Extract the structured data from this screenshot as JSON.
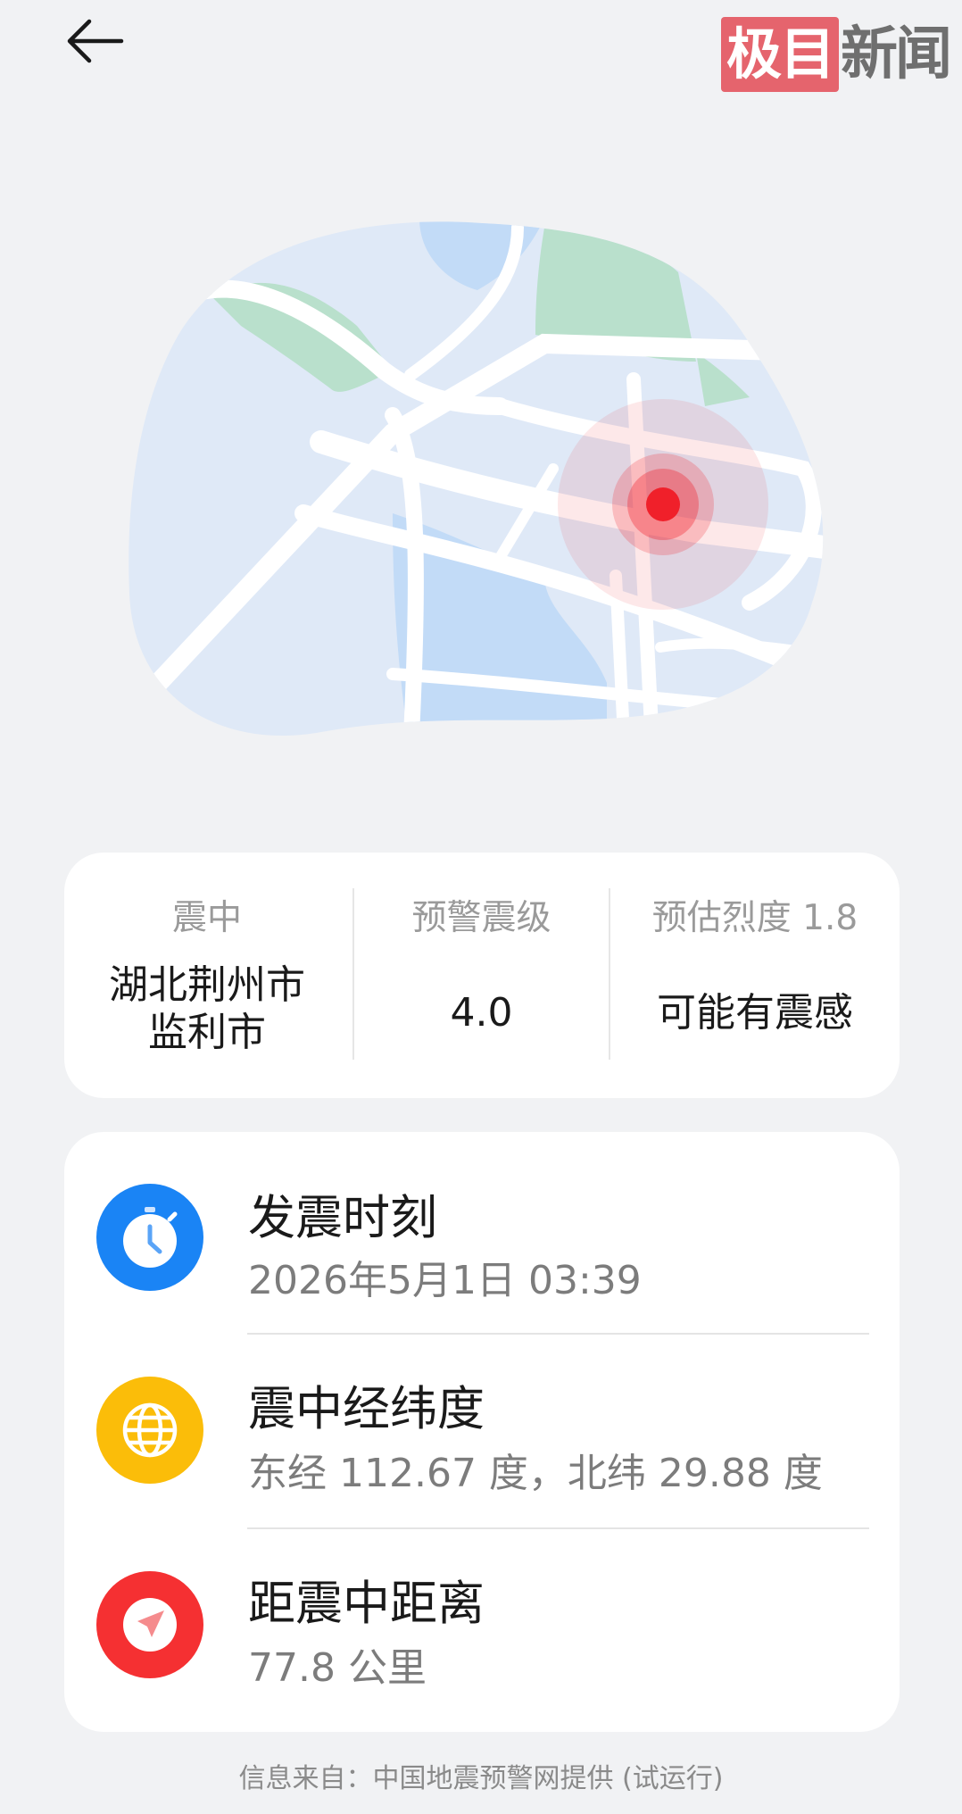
{
  "header": {
    "back_icon": "arrow-left-icon",
    "logo": {
      "highlight": "极目",
      "rest": "新闻"
    }
  },
  "map": {
    "colors": {
      "land": "#dfe9f7",
      "water": "#c2dbf7",
      "park": "#b9e0cc",
      "road": "#ffffff",
      "marker": "#f0202a"
    }
  },
  "summary": {
    "epicenter": {
      "label": "震中",
      "line1": "湖北荆州市",
      "line2": "监利市"
    },
    "magnitude": {
      "label": "预警震级",
      "value": "4.0"
    },
    "intensity": {
      "label": "预估烈度 1.8",
      "value": "可能有震感"
    }
  },
  "details": [
    {
      "title": "发震时刻",
      "value": "2026年5月1日 03:39",
      "icon": "stopwatch-icon",
      "color": "#1a84f5"
    },
    {
      "title": "震中经纬度",
      "value": "东经 112.67 度，北纬 29.88 度",
      "icon": "globe-icon",
      "color": "#fbbd09"
    },
    {
      "title": "距震中距离",
      "value": "77.8 公里",
      "icon": "navigation-arrow-icon",
      "color": "#f53032"
    }
  ],
  "footer": "信息来自：中国地震预警网提供 (试运行)"
}
